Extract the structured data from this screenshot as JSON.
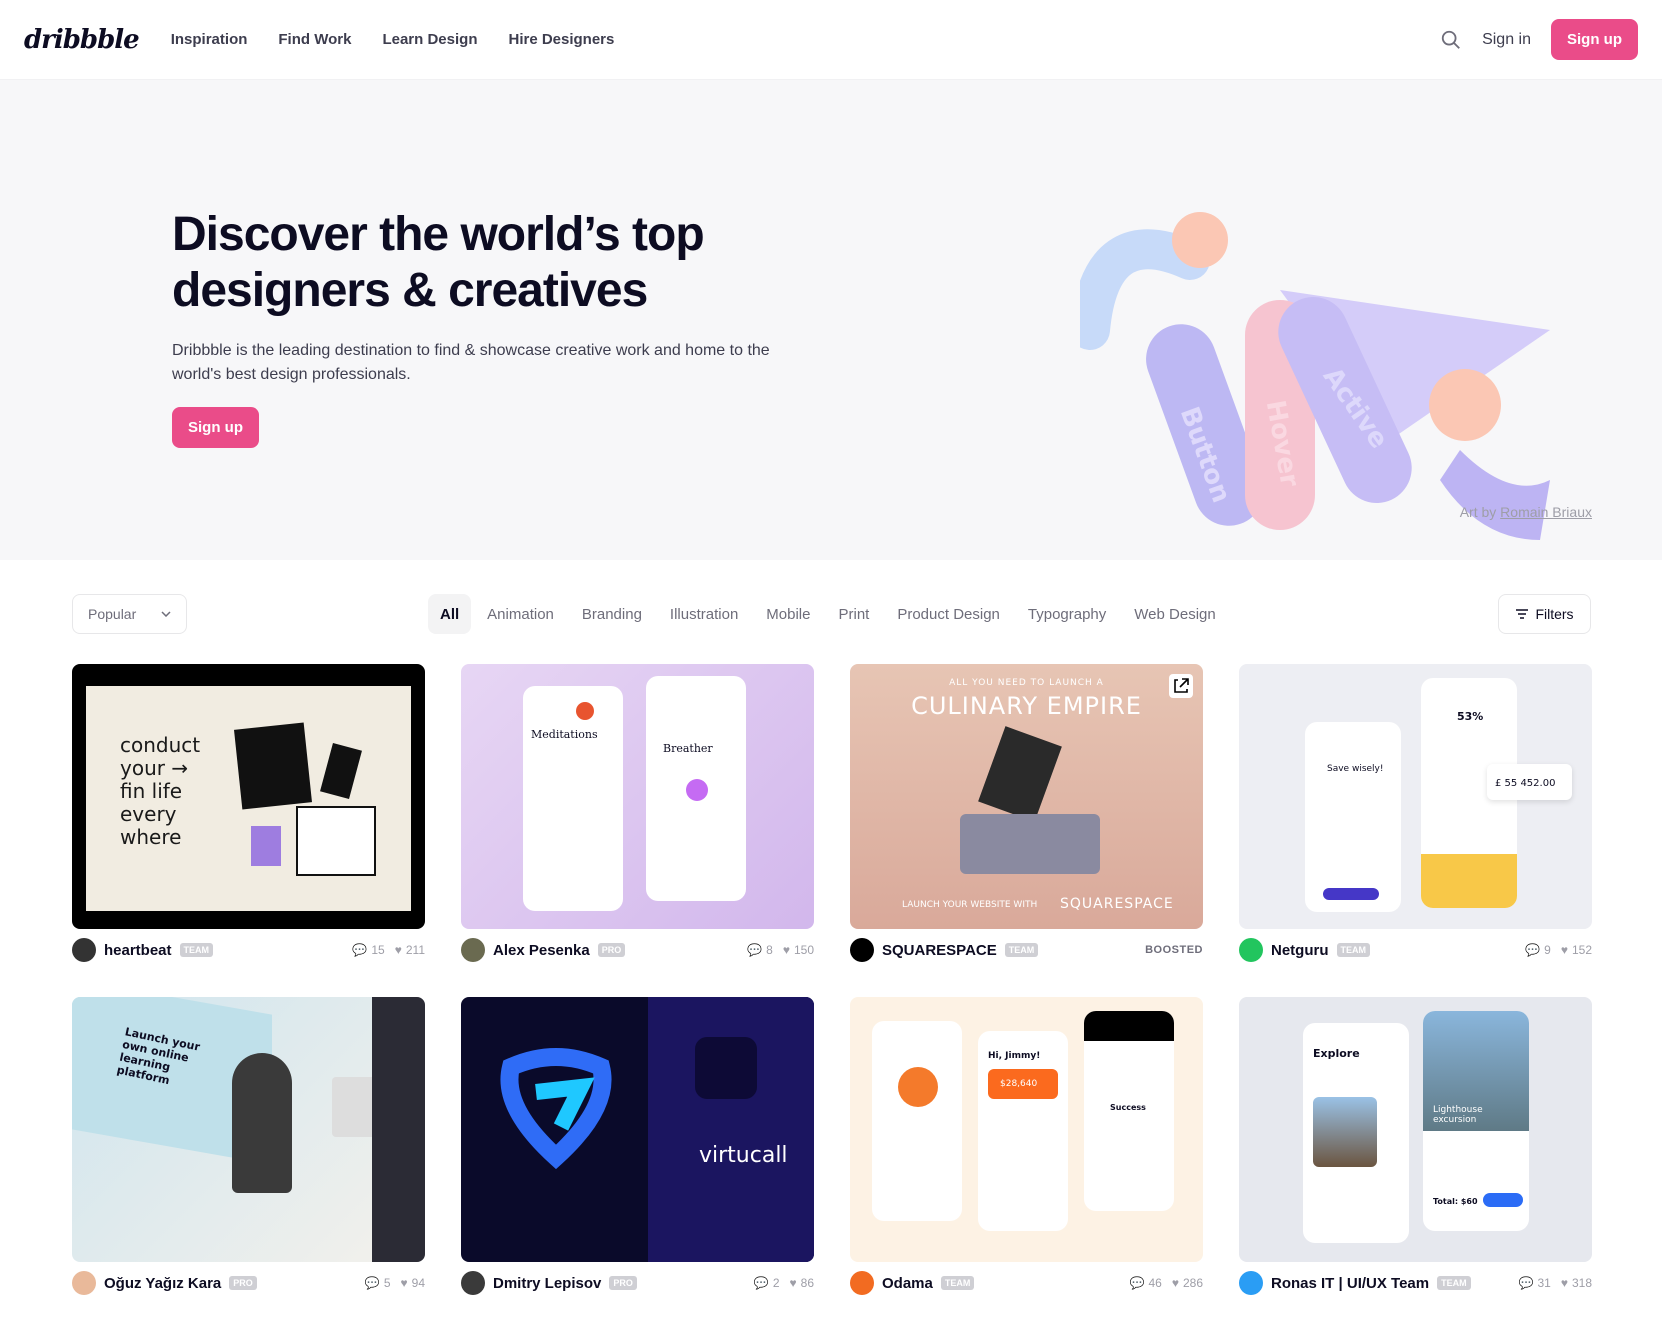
{
  "nav": {
    "logo": "dribbble",
    "links": [
      "Inspiration",
      "Find Work",
      "Learn Design",
      "Hire Designers"
    ],
    "sign_in": "Sign in",
    "sign_up": "Sign up"
  },
  "hero": {
    "title": "Discover the world’s top designers & creatives",
    "subtitle": "Dribbble is the leading destination to find & showcase creative work and home to the world's best design professionals.",
    "cta": "Sign up",
    "credit_prefix": "Art by",
    "credit_name": "Romain Briaux",
    "tags": [
      "Button",
      "Hover",
      "Active"
    ]
  },
  "filters": {
    "sort": "Popular",
    "categories": [
      "All",
      "Animation",
      "Branding",
      "Illustration",
      "Mobile",
      "Print",
      "Product Design",
      "Typography",
      "Web Design"
    ],
    "active_category": "All",
    "filters_label": "Filters"
  },
  "shots": [
    {
      "author": "heartbeat",
      "badge": "TEAM",
      "comments": "15",
      "likes": "211",
      "thumb_text": [
        "conduct",
        "your →",
        "fin life",
        "every",
        "where"
      ]
    },
    {
      "author": "Alex Pesenka",
      "badge": "PRO",
      "comments": "8",
      "likes": "150",
      "thumb_text": [
        "Meditations",
        "Breather"
      ]
    },
    {
      "author": "SQUARESPACE",
      "badge": "TEAM",
      "boosted": "BOOSTED",
      "thumb_text": [
        "ALL YOU NEED TO LAUNCH A",
        "CULINARY EMPIRE",
        "LAUNCH YOUR WEBSITE WITH",
        "SQUARESPACE"
      ]
    },
    {
      "author": "Netguru",
      "badge": "TEAM",
      "comments": "9",
      "likes": "152",
      "thumb_text": [
        "Save wisely!",
        "53%",
        "£ 55 452.00"
      ]
    },
    {
      "author": "Oğuz Yağız Kara",
      "badge": "PRO",
      "comments": "5",
      "likes": "94",
      "thumb_text": [
        "Launch your own online learning platform"
      ]
    },
    {
      "author": "Dmitry Lepisov",
      "badge": "PRO",
      "comments": "2",
      "likes": "86",
      "thumb_text": [
        "virtucall"
      ]
    },
    {
      "author": "Odama",
      "badge": "TEAM",
      "comments": "46",
      "likes": "286",
      "thumb_text": [
        "Hi, Jimmy!",
        "$28,640",
        "Success"
      ]
    },
    {
      "author": "Ronas IT | UI/UX Team",
      "badge": "TEAM",
      "comments": "31",
      "likes": "318",
      "thumb_text": [
        "Explore",
        "Lighthouse excursion",
        "Total: $60"
      ]
    }
  ],
  "colors": {
    "brand": "#ea4c89",
    "text": "#0d0c22",
    "muted": "#6e6d7a"
  }
}
